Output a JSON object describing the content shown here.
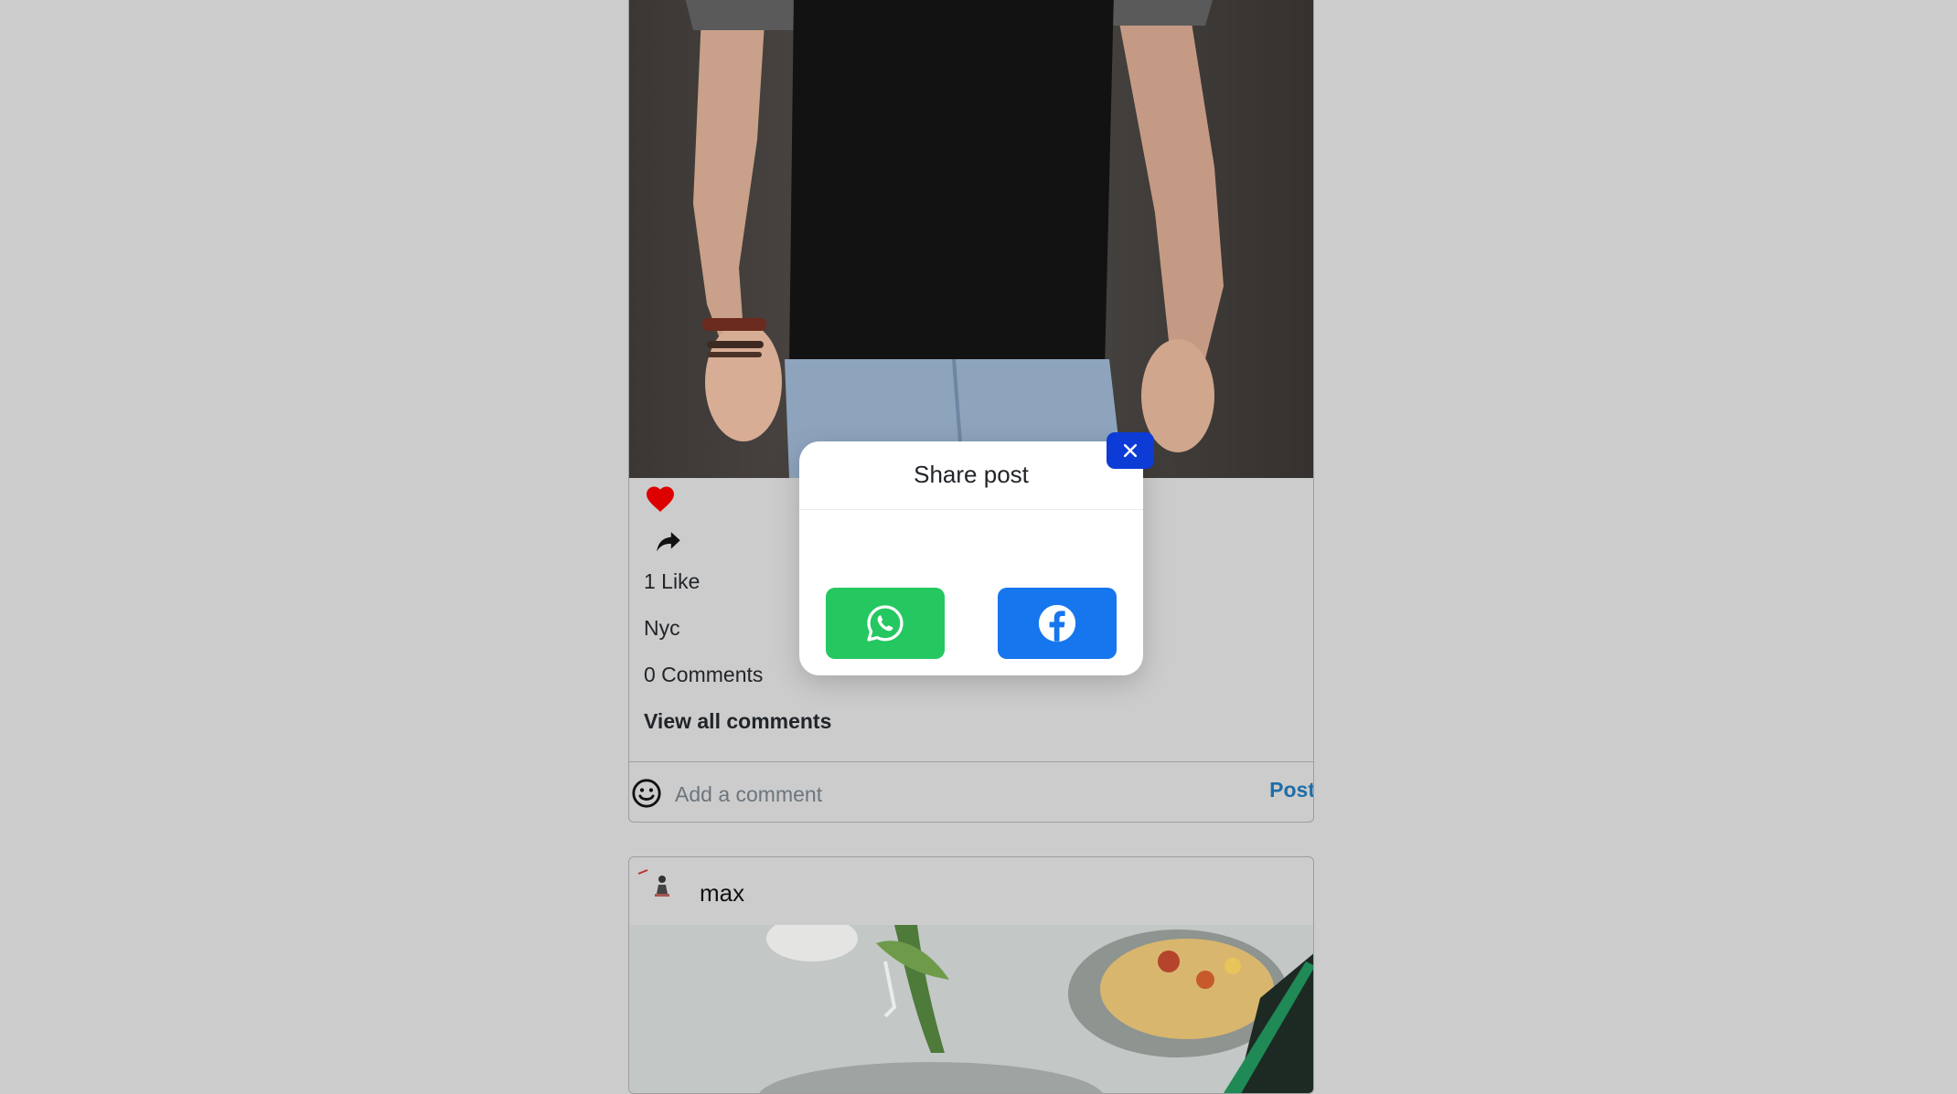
{
  "colors": {
    "background": "#cccccc",
    "heart": "#dd0000",
    "post_link": "#1e6ea8",
    "close_button": "#0d3bd6",
    "whatsapp": "#25c760",
    "facebook": "#1676ee"
  },
  "post1": {
    "image_alt": "man in black t-shirt and jeans",
    "likes_text": "1 Like",
    "caption": "Nyc",
    "comments_text": "0 Comments",
    "view_all_label": "View all comments",
    "comment_placeholder": "Add a comment",
    "post_label": "Post",
    "icons": [
      "heart-icon",
      "share-arrow-icon",
      "smiley-icon"
    ]
  },
  "post2": {
    "username": "max",
    "image_alt": "food salad on plate"
  },
  "share_modal": {
    "title": "Share post",
    "close_icon": "close-icon",
    "options": [
      {
        "name": "WhatsApp",
        "icon": "whatsapp-icon"
      },
      {
        "name": "Facebook",
        "icon": "facebook-icon"
      }
    ]
  }
}
